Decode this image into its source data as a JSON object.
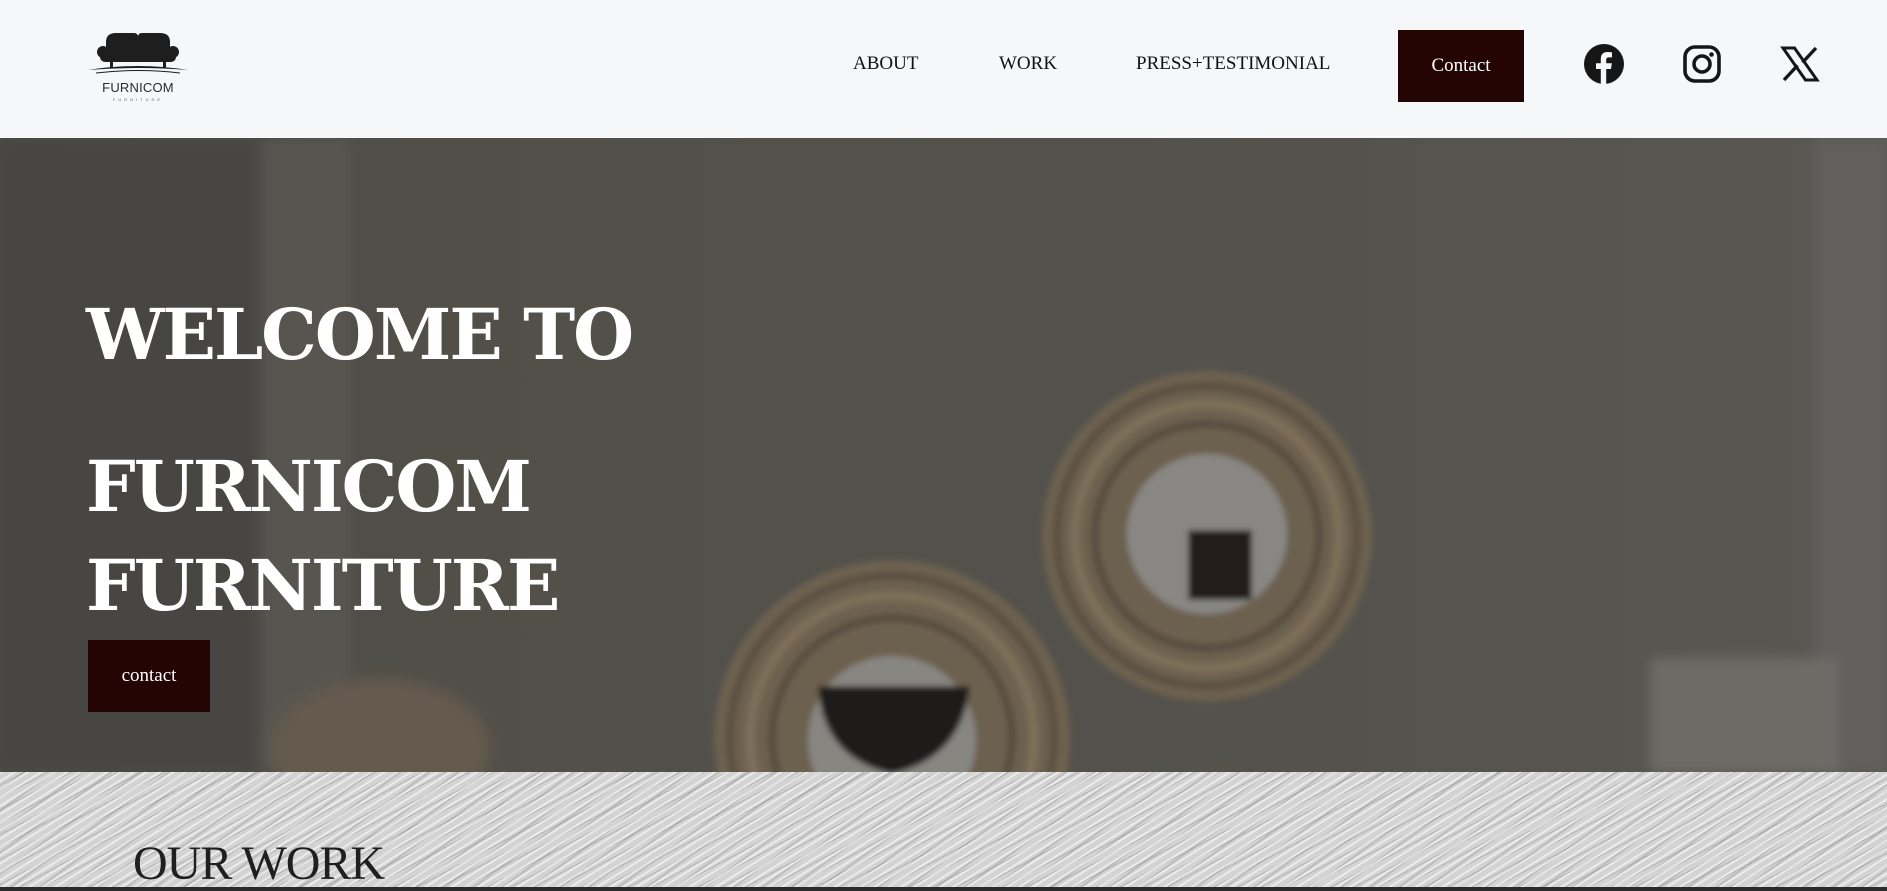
{
  "brand": {
    "name": "FURNICOM",
    "tagline": "FURNITURE",
    "logo_icon": "sofa-icon"
  },
  "nav": {
    "items": [
      {
        "label": "ABOUT"
      },
      {
        "label": "WORK"
      },
      {
        "label": "PRESS+TESTIMONIAL"
      }
    ],
    "contact_label": "Contact"
  },
  "social": [
    {
      "icon": "facebook-icon"
    },
    {
      "icon": "instagram-icon"
    },
    {
      "icon": "x-icon"
    }
  ],
  "hero": {
    "line1": "WELCOME TO",
    "line2": "FURNICOM",
    "line3": "FURNITURE",
    "button_label": "contact",
    "overlay_color": "#5f5d58"
  },
  "work": {
    "title": "OUR WORK"
  },
  "colors": {
    "accent": "#250404",
    "header_bg": "#f6f7f9",
    "text": "#111111"
  }
}
